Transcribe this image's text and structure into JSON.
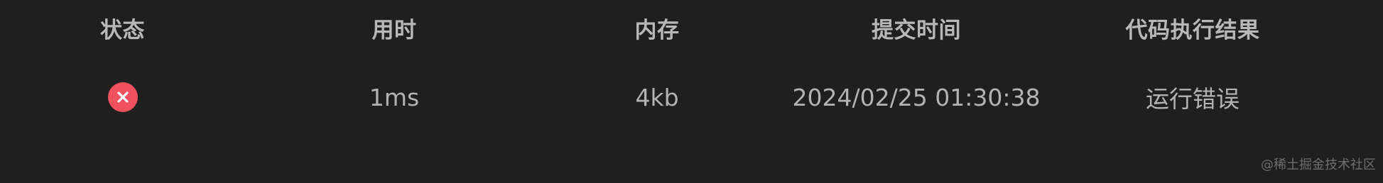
{
  "table": {
    "headers": [
      "状态",
      "用时",
      "内存",
      "提交时间",
      "代码执行结果"
    ],
    "rows": [
      {
        "status_icon": "error-x-circle-icon",
        "status_color": "#f0515e",
        "time": "1ms",
        "memory": "4kb",
        "submitted_at": "2024/02/25 01:30:38",
        "result": "运行错误"
      }
    ]
  },
  "watermark": "@稀土掘金技术社区"
}
